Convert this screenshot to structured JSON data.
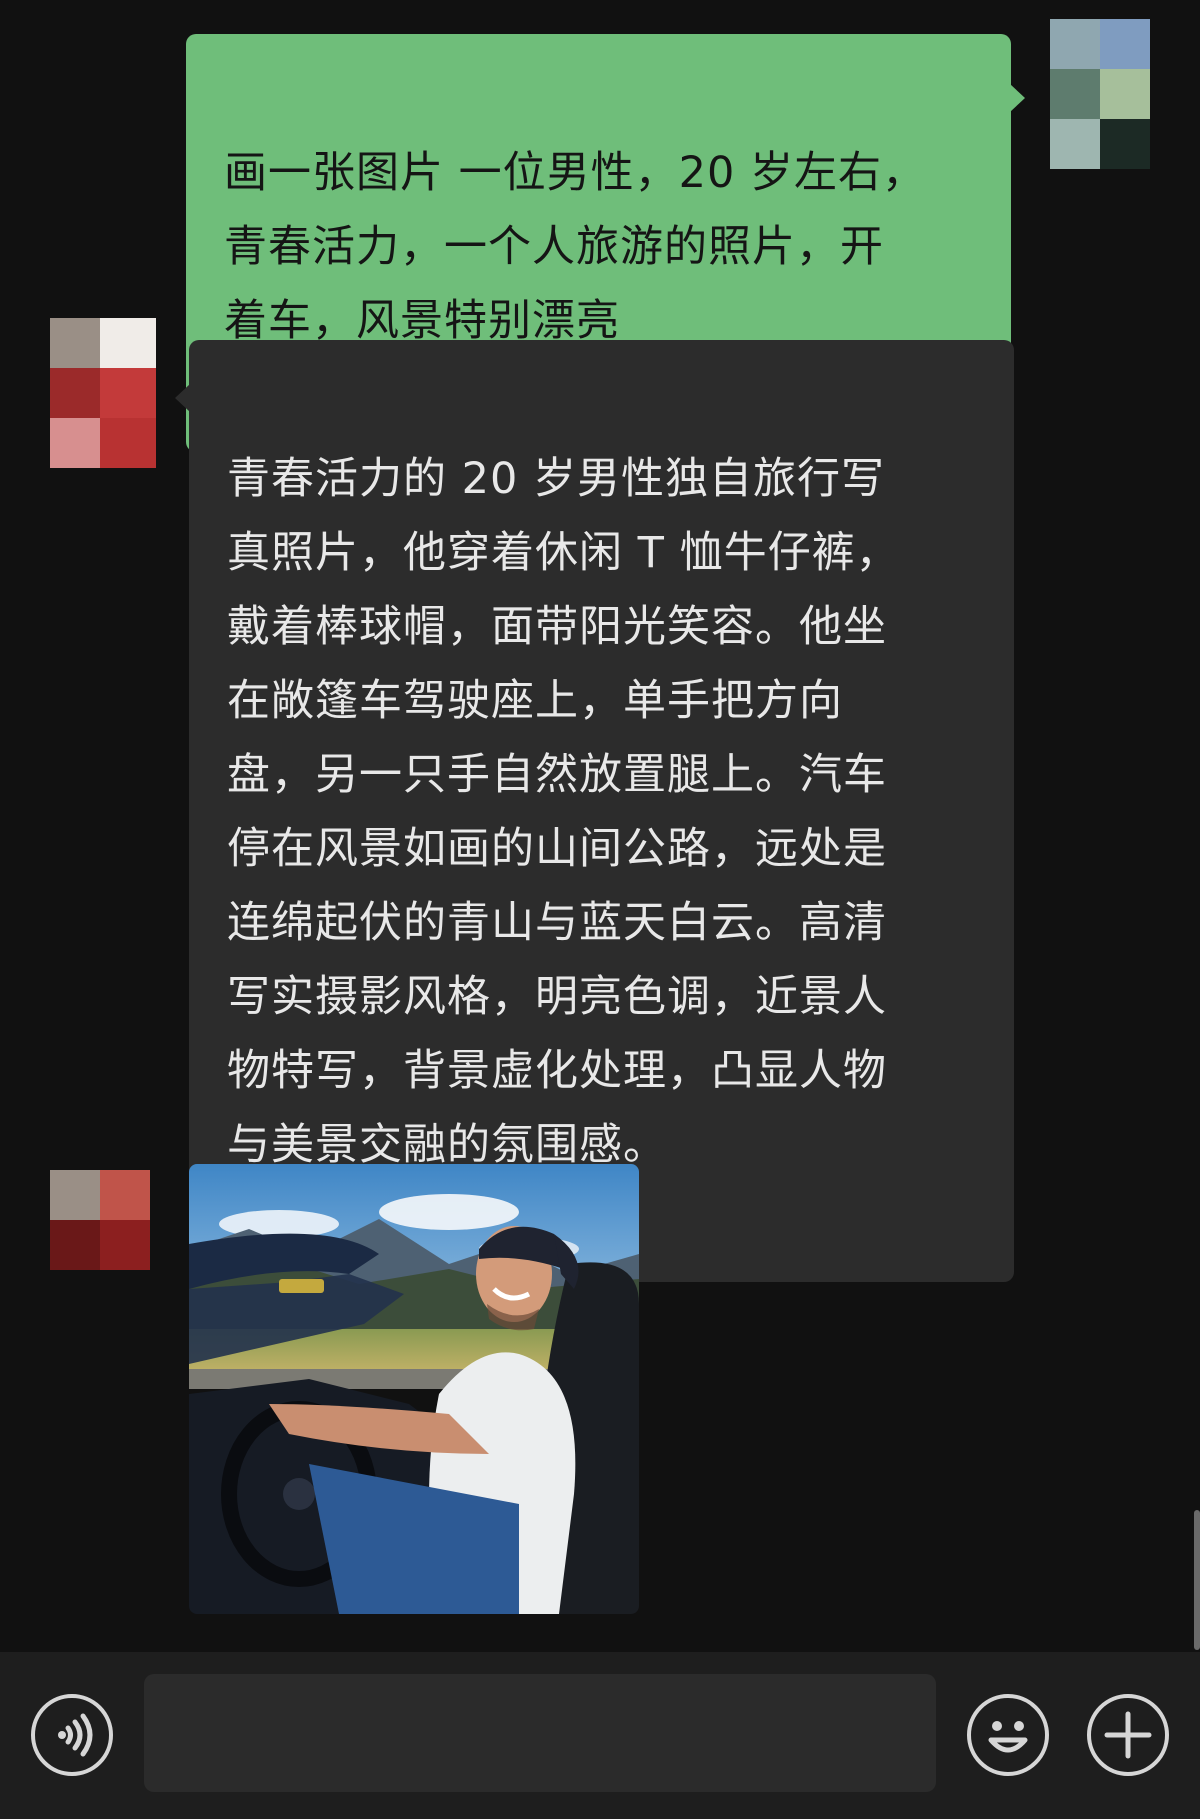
{
  "conversation": {
    "sent_message": "画一张图片 一位男性，20 岁左右，\n青春活力，一个人旅游的照片，开\n着车，风景特别漂亮",
    "reply_message": "青春活力的 20 岁男性独自旅行写\n真照片，他穿着休闲 T 恤牛仔裤，\n戴着棒球帽，面带阳光笑容。他坐\n在敞篷车驾驶座上，单手把方向\n盘，另一只手自然放置腿上。汽车\n停在风景如画的山间公路，远处是\n连绵起伏的青山与蓝天白云。高清\n写实摄影风格，明亮色调，近景人\n物特写，背景虚化处理，凸显人物\n与美景交融的氛围感。",
    "image_message": {
      "depicts": "young man in white t-shirt and backwards cap smiling while driving a convertible on a mountain road"
    }
  },
  "avatars": {
    "self": {
      "pixelated": true,
      "colors": [
        "#8fa7b0",
        "#7f9cc0",
        "#5e7c6e",
        "#a6bf9b",
        "#9eb6b0",
        "#1c2a25"
      ]
    },
    "contact": {
      "pixelated": true,
      "colors": [
        "#9a8f86",
        "#f0ece8",
        "#9b2a2a",
        "#c33a3a",
        "#d78f8f",
        "#6a1818"
      ]
    }
  },
  "input_bar": {
    "icons": [
      "voice-icon",
      "emoji-icon",
      "plus-icon"
    ],
    "message_value": ""
  },
  "colors": {
    "background": "#111111",
    "sent_bubble": "#6fbe7a",
    "received_bubble": "#2c2c2c",
    "input_bar": "#1e1e1e"
  }
}
